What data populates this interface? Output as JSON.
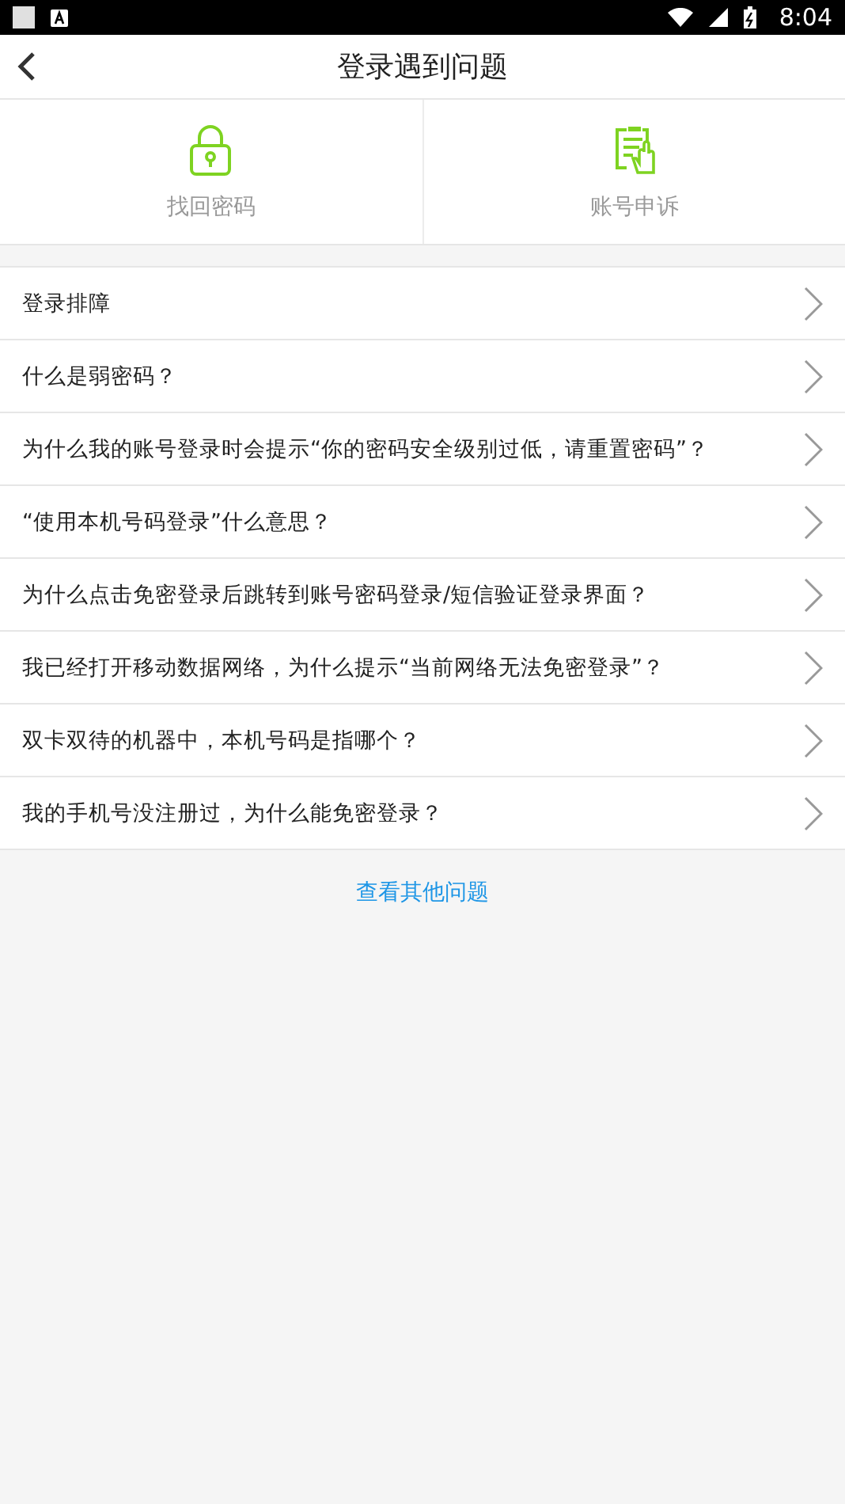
{
  "status_bar": {
    "time": "8:04"
  },
  "header": {
    "title": "登录遇到问题"
  },
  "actions": [
    {
      "kind": "lock",
      "label": "找回密码"
    },
    {
      "kind": "appeal",
      "label": "账号申诉"
    }
  ],
  "questions": [
    "登录排障",
    "什么是弱密码？",
    "为什么我的账号登录时会提示“你的密码安全级别过低，请重置密码”？",
    "“使用本机号码登录”什么意思？",
    "为什么点击免密登录后跳转到账号密码登录/短信验证登录界面？",
    "我已经打开移动数据网络，为什么提示“当前网络无法免密登录”？",
    "双卡双待的机器中，本机号码是指哪个？",
    "我的手机号没注册过，为什么能免密登录？"
  ],
  "more_link": "查看其他问题"
}
